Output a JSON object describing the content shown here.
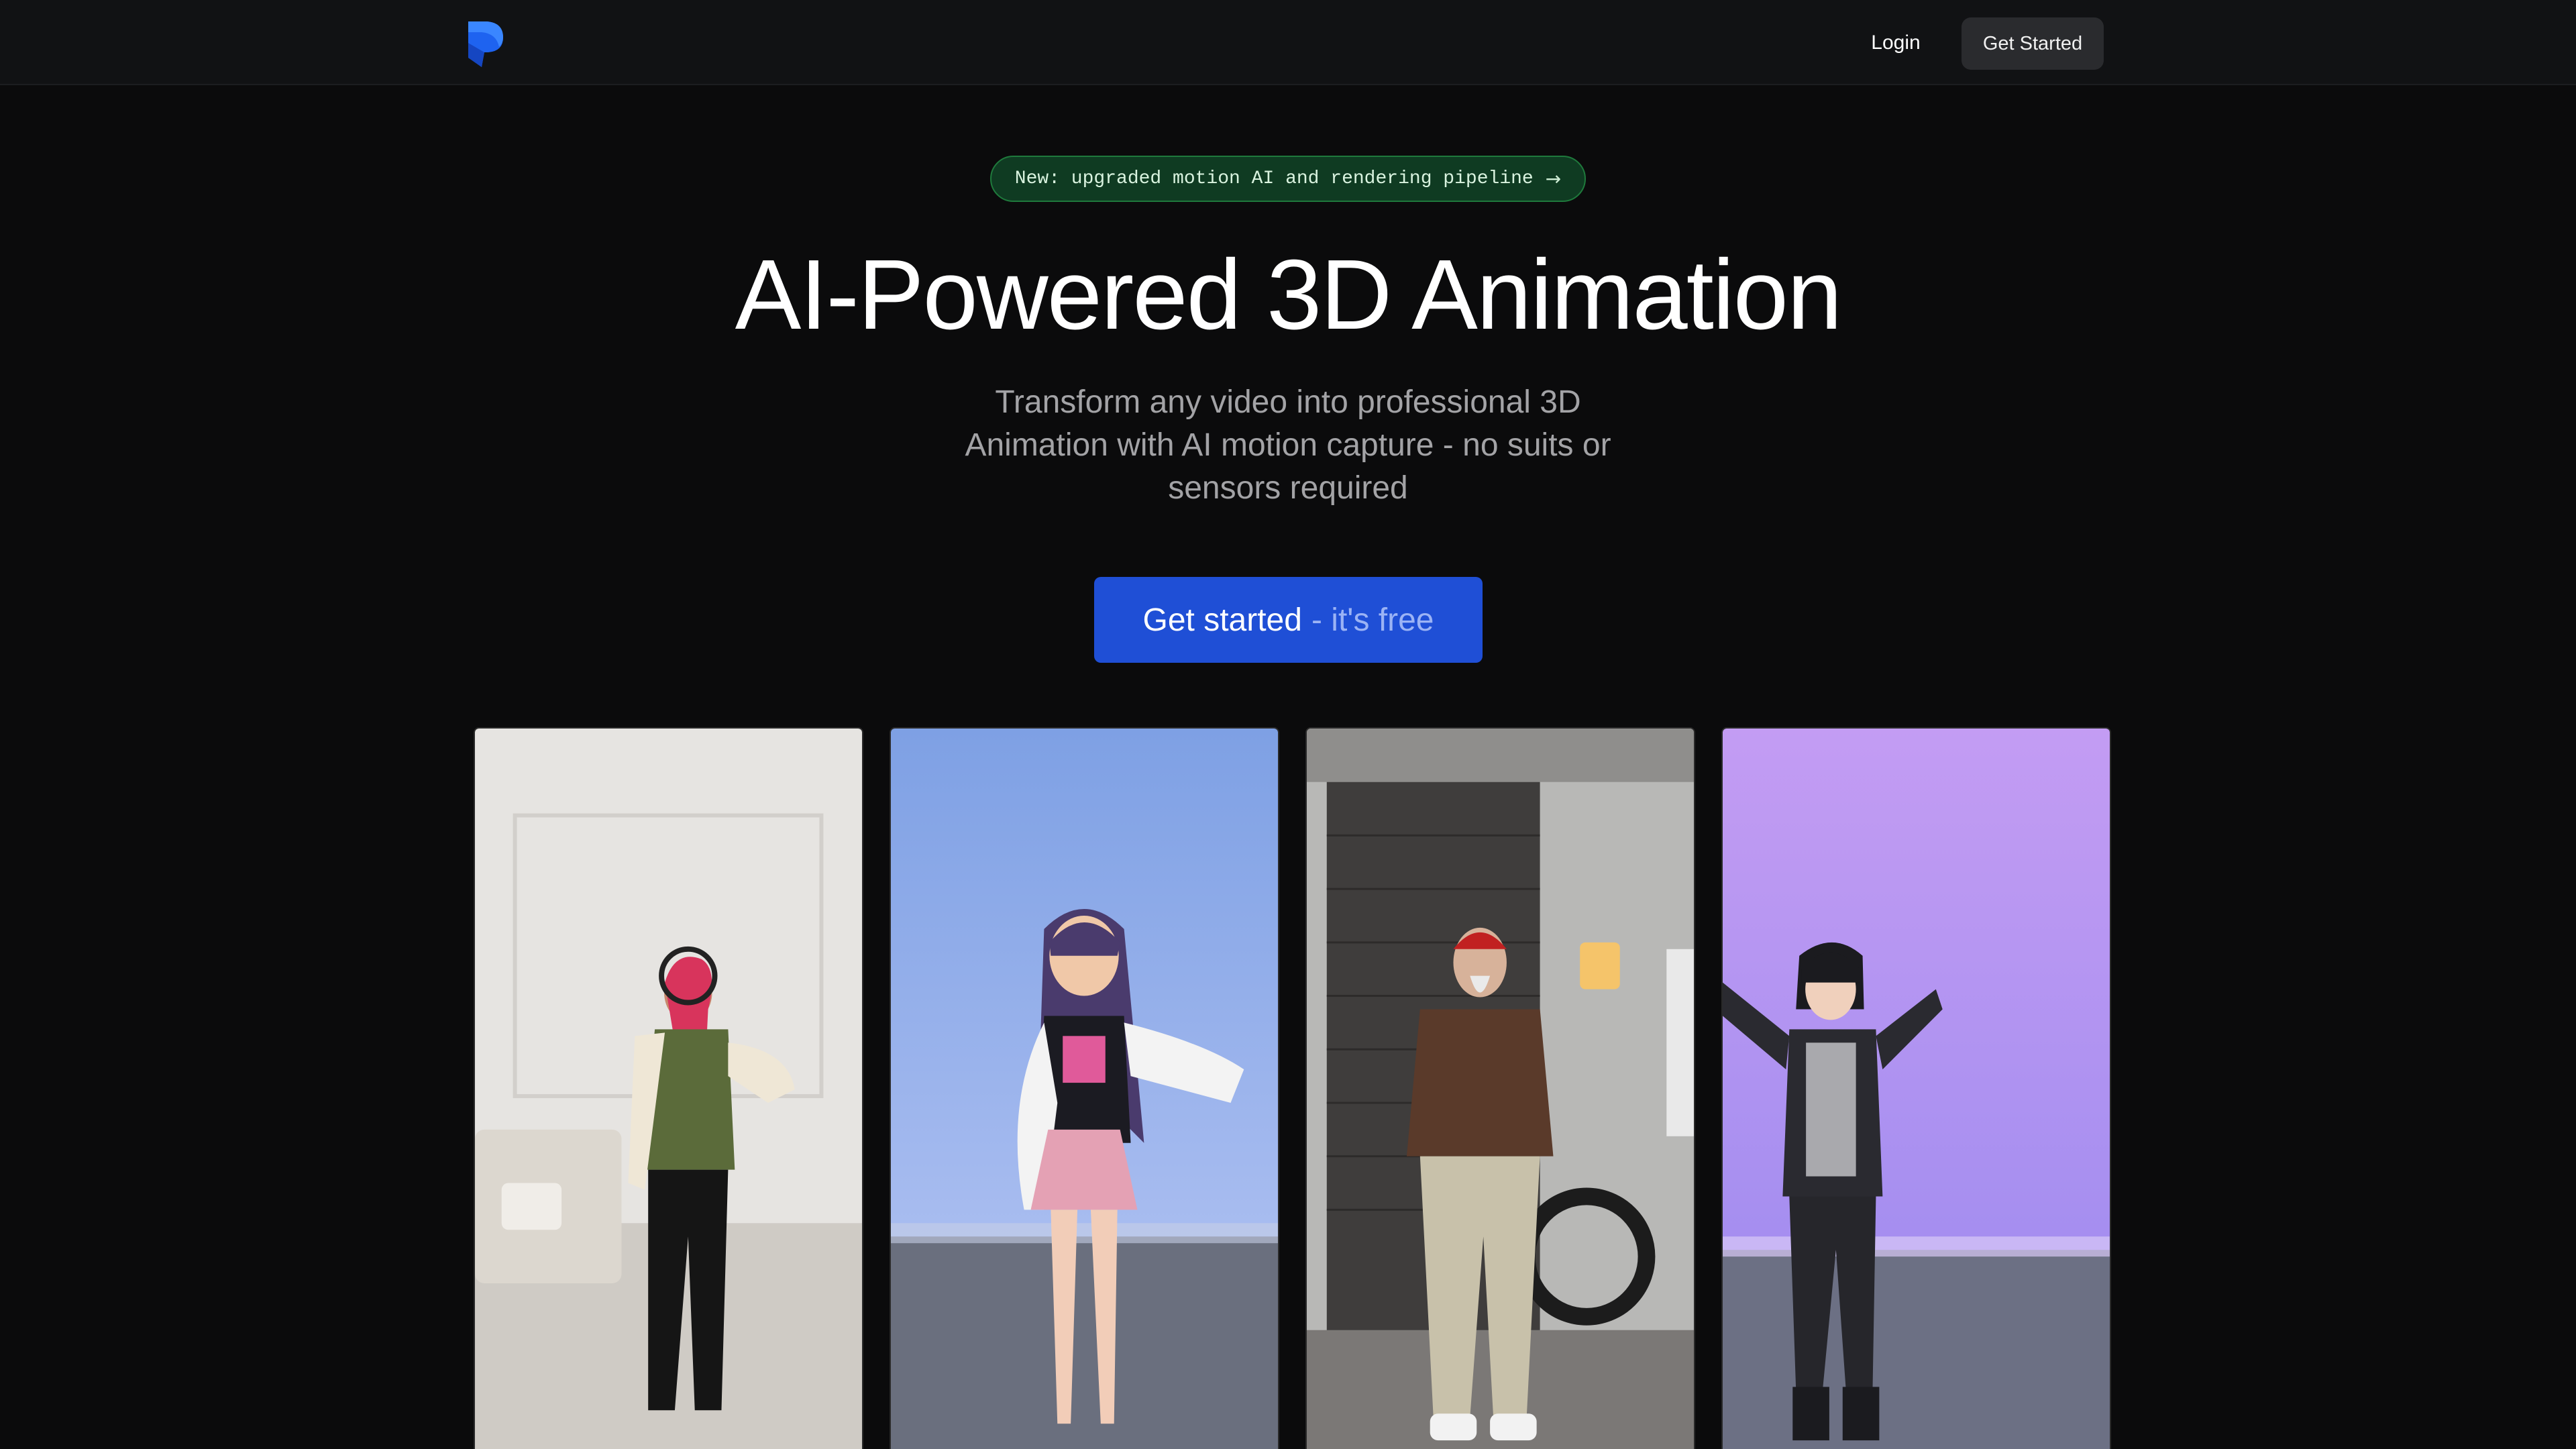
{
  "header": {
    "logo_icon": "brand-logo-icon",
    "login_label": "Login",
    "get_started_label": "Get Started"
  },
  "announcement": {
    "text": "New: upgraded motion AI and rendering pipeline",
    "icon": "arrow-right-icon"
  },
  "hero": {
    "title": "AI-Powered 3D Animation",
    "subtitle": "Transform any video into professional 3D Animation with AI motion capture - no suits or sensors required"
  },
  "cta": {
    "main_label": "Get started",
    "secondary_label": "- it's free"
  },
  "colors": {
    "accent": "#1f4fd6",
    "announcement_bg": "#0f3b22",
    "page_bg": "#0b0b0c"
  }
}
